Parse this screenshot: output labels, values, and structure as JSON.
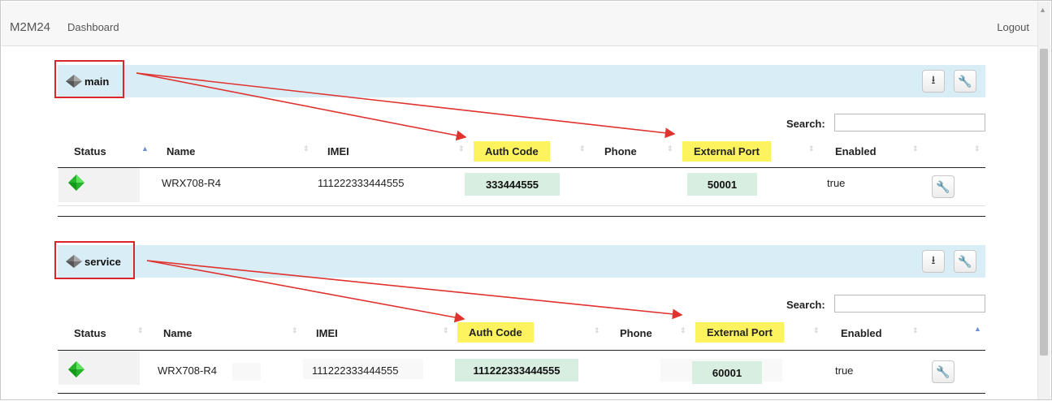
{
  "navbar": {
    "brand": "M2M24",
    "dashboard": "Dashboard",
    "logout": "Logout"
  },
  "colors": {
    "highlight_yellow": "#fdf35e",
    "highlight_green": "#d8eee0",
    "annotation_red": "#d9262a",
    "panel_head": "#d9edf7",
    "status_green": "#2ecc40"
  },
  "icons": {
    "group": "gray-cube-icon",
    "status": "green-diamond-icon",
    "download": "download-icon",
    "wrench": "wrench-icon"
  },
  "search_label": "Search:",
  "columns": [
    "Status",
    "Name",
    "IMEI",
    "Auth Code",
    "Phone",
    "External Port",
    "Enabled"
  ],
  "groups": [
    {
      "name": "main",
      "rows": [
        {
          "name": "WRX708-R4",
          "imei": "111222333444555",
          "auth_code": "333444555",
          "phone": "",
          "external_port": "50001",
          "enabled": "true"
        }
      ]
    },
    {
      "name": "service",
      "rows": [
        {
          "name": "WRX708-R4",
          "imei": "111222333444555",
          "auth_code": "111222333444555",
          "phone": "",
          "external_port": "60001",
          "enabled": "true"
        }
      ]
    }
  ]
}
